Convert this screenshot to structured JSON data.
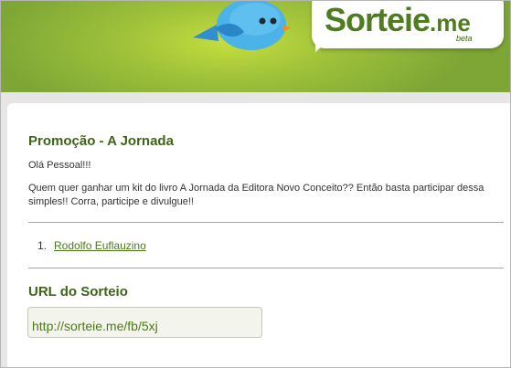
{
  "header": {
    "logo_main": "Sorteie",
    "logo_suffix": ".me",
    "logo_beta": "beta"
  },
  "raffle": {
    "title": "Promoção - A Jornada",
    "greeting": "Olá Pessoal!!!",
    "description_line1": "Quem quer ganhar um kit do livro A Jornada da Editora Novo Conceito?? Então basta participar dessa",
    "description_line2": "simples!! Corra, participe e divulgue!!"
  },
  "winners": [
    {
      "number": "1.",
      "name": "Rodolfo Euflauzino"
    }
  ],
  "url_section": {
    "heading": "URL do Sorteio",
    "url": "http://sorteie.me/fb/5xj"
  },
  "colors": {
    "brand_green": "#3e6417",
    "banner_green": "#9fc23a",
    "bird_blue": "#3fa8e0"
  }
}
